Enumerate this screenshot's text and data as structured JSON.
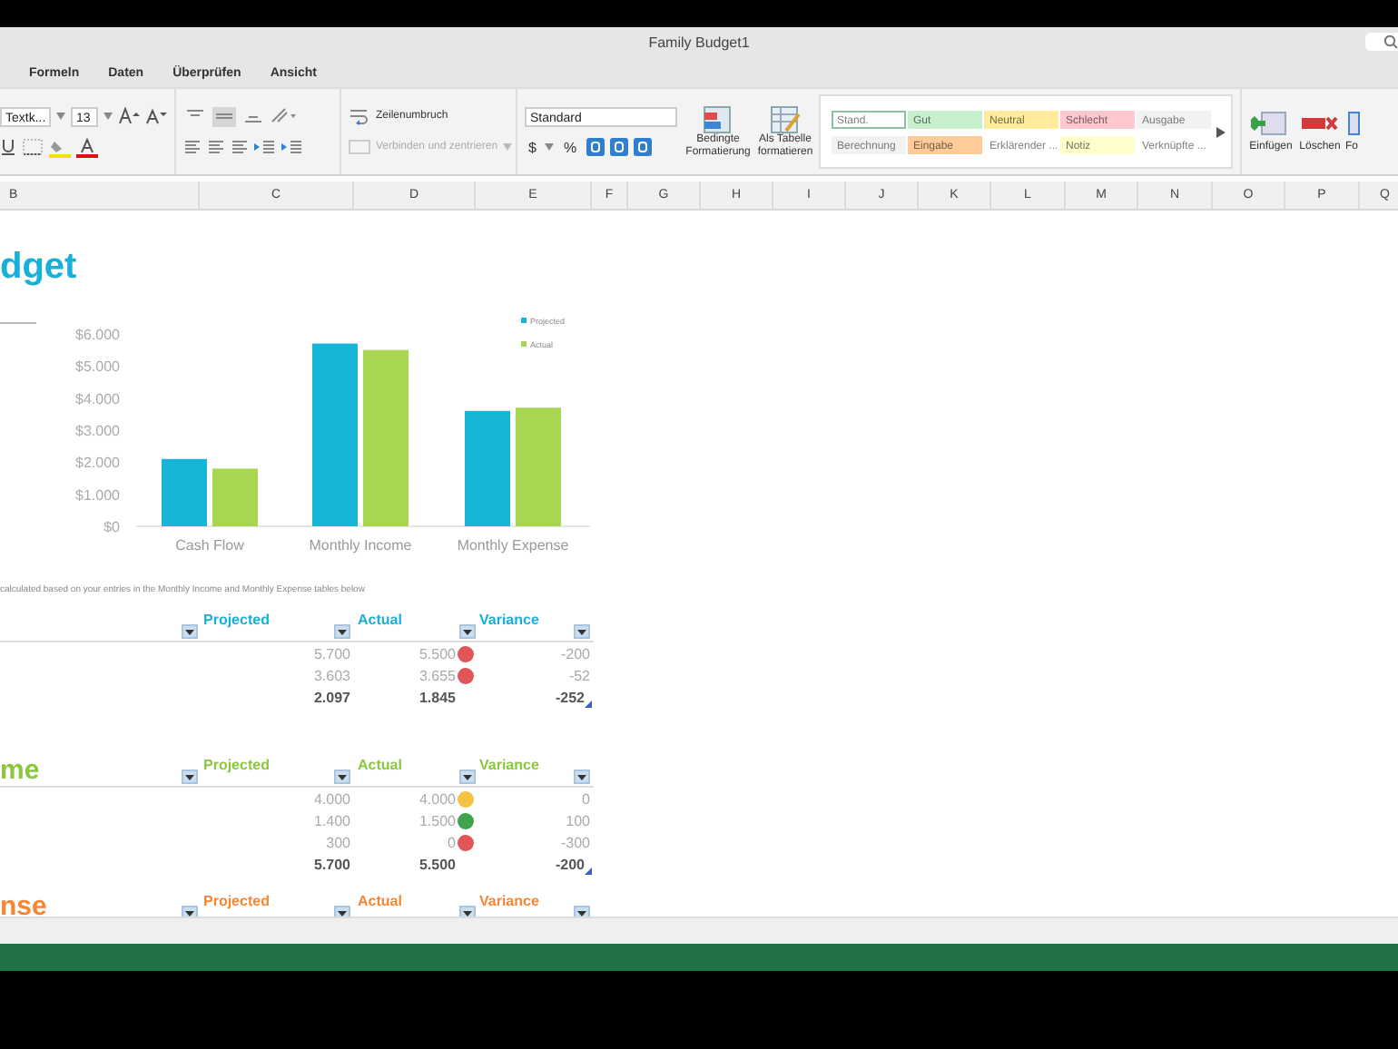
{
  "window": {
    "title": "Family Budget1"
  },
  "tabs": [
    {
      "label": "Formeln",
      "selected": false
    },
    {
      "label": "Daten",
      "selected": false
    },
    {
      "label": "Überprüfen",
      "selected": false
    },
    {
      "label": "Ansicht",
      "selected": false
    }
  ],
  "ribbon": {
    "font": "Textk...",
    "font_size": "13",
    "vertical_align": [
      {
        "kind": "top",
        "selected": false
      },
      {
        "kind": "middle",
        "selected": true
      },
      {
        "kind": "bottom",
        "selected": false
      }
    ],
    "wrap": "Zeilenumbruch",
    "merge": "Verbinden und zentrieren",
    "merge_disabled": true,
    "number_format": "Standard",
    "currency": "$",
    "percent": "%",
    "conditional": "Bedingte Formatierung",
    "as_table": "Als Tabelle formatieren",
    "styles": [
      {
        "label": "Stand.",
        "color": "#ffffff",
        "selected": true
      },
      {
        "label": "Gut",
        "color": "#c6efce",
        "selected": false
      },
      {
        "label": "Neutral",
        "color": "#ffeb9c",
        "selected": false
      },
      {
        "label": "Schlecht",
        "color": "#ffc7ce",
        "selected": false
      },
      {
        "label": "Ausgabe",
        "color": "#f2f2f2",
        "selected": false
      },
      {
        "label": "Berechnung",
        "color": "#f2f2f2",
        "selected": false
      },
      {
        "label": "Eingabe",
        "color": "#ffcc99",
        "selected": false
      },
      {
        "label": "Erklärender ...",
        "color": "#ffffff",
        "selected": false
      },
      {
        "label": "Notiz",
        "color": "#ffffcc",
        "selected": false
      },
      {
        "label": "Verknüpfte ...",
        "color": "#ffffff",
        "selected": false
      }
    ],
    "insert": "Einfügen",
    "delete": "Löschen",
    "format": "Fo"
  },
  "column_headers": [
    "B",
    "C",
    "D",
    "E",
    "F",
    "G",
    "H",
    "I",
    "J",
    "K",
    "L",
    "M",
    "N",
    "O",
    "P",
    "Q"
  ],
  "sheet_title": "dget",
  "chart_data": {
    "type": "bar",
    "categories": [
      "Cash Flow",
      "Monthly Income",
      "Monthly Expense"
    ],
    "series": [
      {
        "name": "Projected",
        "color": "#17b5d6",
        "values": [
          2100,
          5700,
          3600
        ]
      },
      {
        "name": "Actual",
        "color": "#a9d651",
        "values": [
          1800,
          5500,
          3700
        ]
      }
    ],
    "legend": true,
    "ylim": [
      0,
      6000
    ],
    "yticks": [
      {
        "value": 0,
        "label": "$0"
      },
      {
        "value": 1000,
        "label": "$1.000"
      },
      {
        "value": 2000,
        "label": "$2.000"
      },
      {
        "value": 3000,
        "label": "$3.000"
      },
      {
        "value": 4000,
        "label": "$4.000"
      },
      {
        "value": 5000,
        "label": "$5.000"
      },
      {
        "value": 6000,
        "label": "$6.000"
      }
    ]
  },
  "note": "calculated based on your entries in the Monthly Income and Monthly Expense tables below",
  "tables": [
    {
      "color": "#17b0d8",
      "columns": [
        "Projected",
        "Actual",
        "Variance"
      ],
      "rows": [
        {
          "kind": "data",
          "projected": "5.700",
          "actual": "5.500",
          "color": "#e0555a",
          "variance": "-200"
        },
        {
          "kind": "data",
          "projected": "3.603",
          "actual": "3.655",
          "color": "#e0555a",
          "variance": "-52"
        },
        {
          "kind": "total",
          "projected": "2.097",
          "actual": "1.845",
          "variance": "-252"
        }
      ]
    },
    {
      "title": "me",
      "color": "#8cc63f",
      "columns": [
        "Projected",
        "Actual",
        "Variance"
      ],
      "rows": [
        {
          "kind": "data",
          "projected": "4.000",
          "actual": "4.000",
          "color": "#f5c242",
          "variance": "0"
        },
        {
          "kind": "data",
          "projected": "1.400",
          "actual": "1.500",
          "color": "#3fa34d",
          "variance": "100"
        },
        {
          "kind": "data",
          "projected": "300",
          "actual": "0",
          "color": "#e0555a",
          "variance": "-300"
        },
        {
          "kind": "total",
          "projected": "5.700",
          "actual": "5.500",
          "variance": "-200"
        }
      ]
    },
    {
      "title": "nse",
      "color": "#f58634",
      "columns": [
        "Projected",
        "Actual",
        "Variance"
      ]
    }
  ]
}
